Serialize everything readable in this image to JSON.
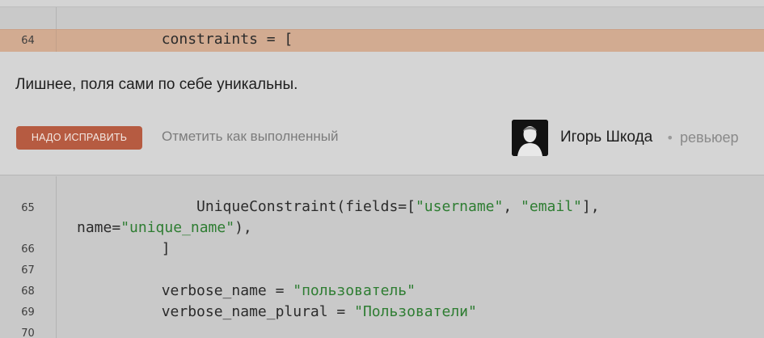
{
  "code_lines": {
    "l64": {
      "num": "64",
      "text": "        constraints = ["
    },
    "l65": {
      "num": "65",
      "indent": "            UniqueConstraint(fields=[",
      "s1": "\"username\"",
      "sep": ", ",
      "s2": "\"email\"",
      "tail": "],"
    },
    "l65b": {
      "text": "name=",
      "s": "\"unique_name\"",
      "tail": "),"
    },
    "l66": {
      "num": "66",
      "text": "        ]"
    },
    "l67": {
      "num": "67"
    },
    "l68": {
      "num": "68",
      "text": "        verbose_name = ",
      "s": "\"пользователь\""
    },
    "l69": {
      "num": "69",
      "text": "        verbose_name_plural = ",
      "s": "\"Пользователи\""
    },
    "l70": {
      "num": "70"
    }
  },
  "comment": {
    "text": "Лишнее, поля сами по себе уникальны.",
    "fix_button": "НАДО ИСПРАВИТЬ",
    "mark_done": "Отметить как выполненный",
    "reviewer_name": "Игорь Шкода",
    "separator": "•",
    "reviewer_role": "ревьюер"
  },
  "colors": {
    "string": "#2e7d32",
    "fix_button": "#b65b41",
    "highlight": "#d2ab91"
  },
  "icons": {
    "avatar": "user-avatar-icon"
  }
}
